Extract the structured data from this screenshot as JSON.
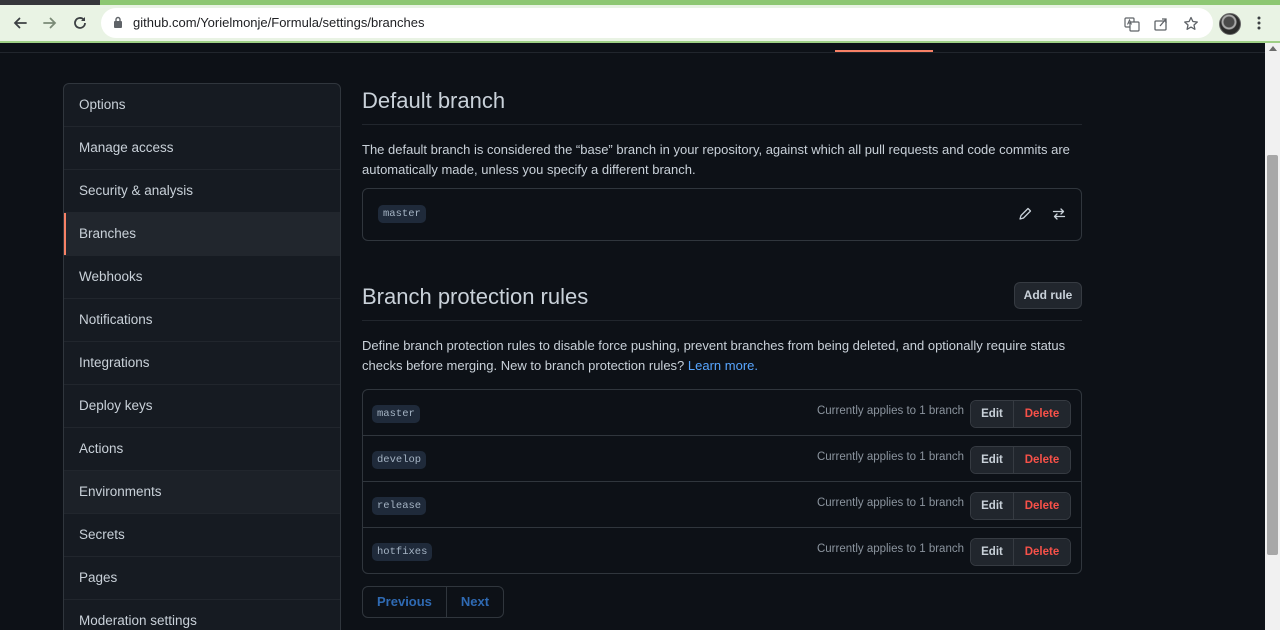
{
  "browser": {
    "url": "github.com/Yorielmonje/Formula/settings/branches"
  },
  "sidebar": {
    "items": [
      {
        "label": "Options"
      },
      {
        "label": "Manage access"
      },
      {
        "label": "Security & analysis"
      },
      {
        "label": "Branches"
      },
      {
        "label": "Webhooks"
      },
      {
        "label": "Notifications"
      },
      {
        "label": "Integrations"
      },
      {
        "label": "Deploy keys"
      },
      {
        "label": "Actions"
      },
      {
        "label": "Environments"
      },
      {
        "label": "Secrets"
      },
      {
        "label": "Pages"
      },
      {
        "label": "Moderation settings"
      }
    ],
    "active": "Branches"
  },
  "default_branch": {
    "title": "Default branch",
    "description": "The default branch is considered the “base” branch in your repository, against which all pull requests and code commits are automatically made, unless you specify a different branch.",
    "branch": "master"
  },
  "protection": {
    "title": "Branch protection rules",
    "add_rule_label": "Add rule",
    "description": "Define branch protection rules to disable force pushing, prevent branches from being deleted, and optionally require status checks before merging. New to branch protection rules?",
    "learn_more": "Learn more.",
    "rules": [
      {
        "name": "master",
        "applies": "Currently applies to 1 branch"
      },
      {
        "name": "develop",
        "applies": "Currently applies to 1 branch"
      },
      {
        "name": "release",
        "applies": "Currently applies to 1 branch"
      },
      {
        "name": "hotfixes",
        "applies": "Currently applies to 1 branch"
      }
    ],
    "edit_label": "Edit",
    "delete_label": "Delete"
  },
  "pagination": {
    "previous": "Previous",
    "next": "Next"
  },
  "colors": {
    "accent": "#f78166",
    "link": "#58a6ff",
    "danger": "#f85149",
    "background": "#0d1117"
  }
}
